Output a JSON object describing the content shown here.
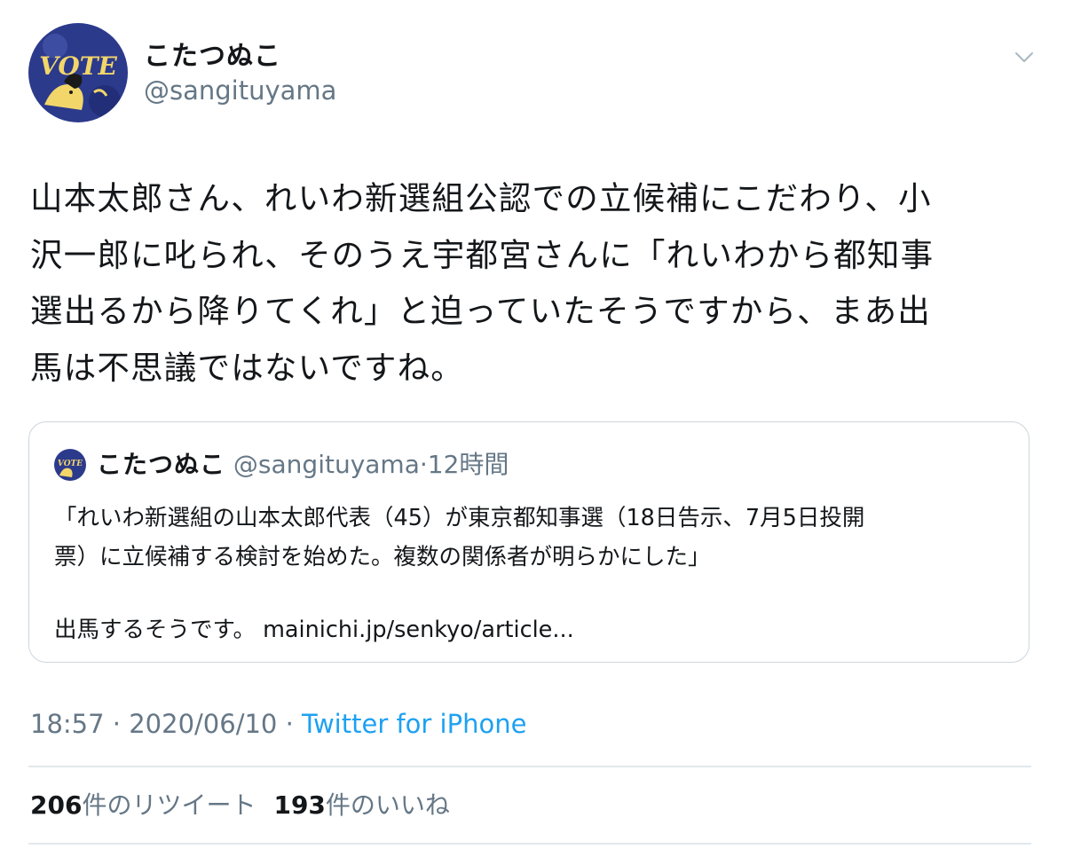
{
  "author": {
    "display_name": "こたつぬこ",
    "handle": "@sangituyama",
    "avatar_text": "VOTE"
  },
  "tweet": {
    "text": "山本太郎さん、れいわ新選組公認での立候補にこだわり、小\n沢一郎に叱られ、そのうえ宇都宮さんに「れいわから都知事\n選出るから降りてくれ」と迫っていたそうですから、まあ出\n馬は不思議ではないですね。"
  },
  "quoted_tweet": {
    "display_name": "こたつぬこ",
    "handle": "@sangituyama",
    "separator": "·",
    "time": "12時間",
    "avatar_text": "VOTE",
    "body": "「れいわ新選組の山本太郎代表（45）が東京都知事選（18日告示、7月5日投開\n票）に立候補する検討を始めた。複数の関係者が明らかにした」",
    "link_prefix": "出馬するそうです。 ",
    "link_text": "mainichi.jp/senkyo/article..."
  },
  "meta": {
    "time": "18:57",
    "separator1": " · ",
    "date": "2020/06/10",
    "separator2": " · ",
    "source": "Twitter for iPhone"
  },
  "stats": {
    "retweets_count": "206",
    "retweets_label": "件のリツイート",
    "likes_count": "193",
    "likes_label": "件のいいね"
  },
  "icons": {
    "caret": "chevron-down-icon"
  },
  "colors": {
    "accent": "#1da1f2",
    "secondary_text": "#657786",
    "primary_text": "#14171a",
    "border": "#ccd6dd",
    "avatar_bg": "#2c3a8c",
    "avatar_text": "#f2d66a"
  }
}
